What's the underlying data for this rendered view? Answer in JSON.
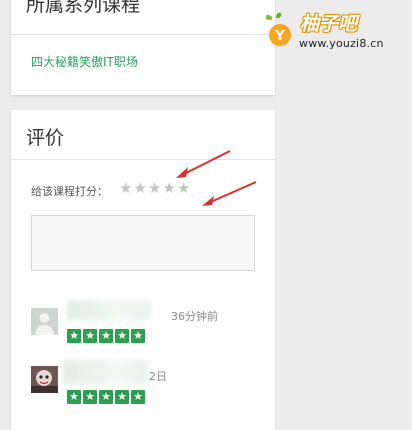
{
  "series": {
    "title": "所属系列课程",
    "link": "四大秘籍笑傲IT职场"
  },
  "review": {
    "title": "评价",
    "rate_label": "给该课程打分：",
    "rate_stars_total": 5,
    "comment_value": "",
    "items": [
      {
        "time": "36分钟前",
        "rating": 5
      },
      {
        "time": "2日",
        "rating": 5
      }
    ]
  },
  "watermark": {
    "logo_text": "柚子吧",
    "url": "www.youzi8.cn"
  },
  "colors": {
    "accent_green": "#27a064",
    "star_green": "#2e9f50",
    "arrow_red": "#d9302c",
    "logo_orange": "#f4a10b"
  },
  "icons": {
    "star_empty": "☆",
    "star_filled": "★"
  }
}
